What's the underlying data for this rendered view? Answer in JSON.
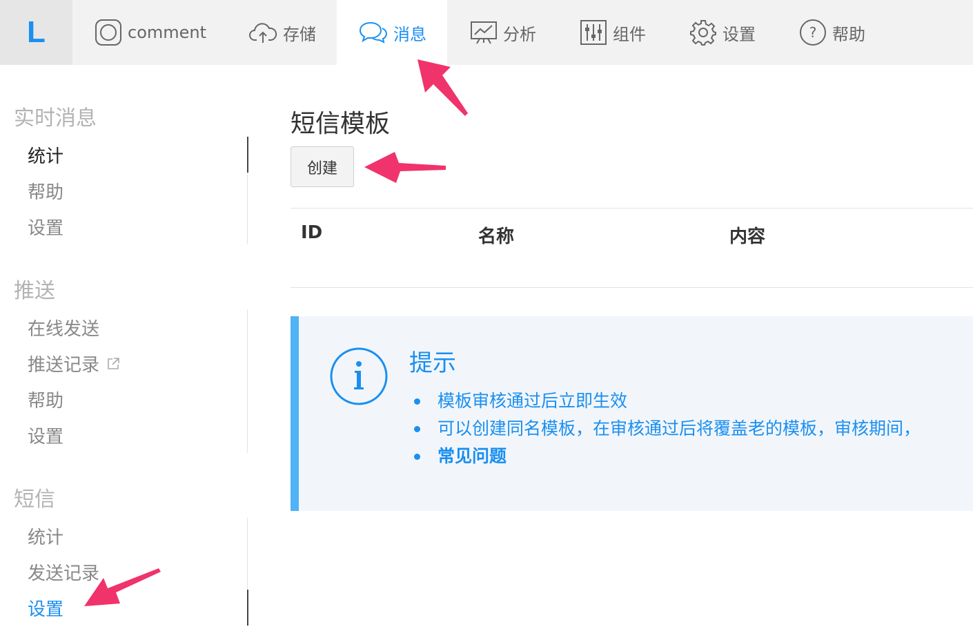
{
  "logo": "L",
  "nav": [
    {
      "label": "comment",
      "icon": "app-square-icon"
    },
    {
      "label": "存储",
      "icon": "cloud-upload-icon"
    },
    {
      "label": "消息",
      "icon": "chat-bubbles-icon",
      "active": true
    },
    {
      "label": "分析",
      "icon": "presentation-chart-icon"
    },
    {
      "label": "组件",
      "icon": "sliders-icon"
    },
    {
      "label": "设置",
      "icon": "gear-icon"
    },
    {
      "label": "帮助",
      "icon": "question-circle-icon"
    }
  ],
  "sidebar": {
    "sections": [
      {
        "title": "实时消息",
        "items": [
          {
            "label": "统计"
          },
          {
            "label": "帮助"
          },
          {
            "label": "设置"
          }
        ]
      },
      {
        "title": "推送",
        "items": [
          {
            "label": "在线发送"
          },
          {
            "label": "推送记录",
            "icon": "external-link-icon"
          },
          {
            "label": "帮助"
          },
          {
            "label": "设置"
          }
        ]
      },
      {
        "title": "短信",
        "items": [
          {
            "label": "统计"
          },
          {
            "label": "发送记录"
          },
          {
            "label": "设置",
            "selected": true
          }
        ]
      }
    ]
  },
  "main": {
    "title": "短信模板",
    "create_label": "创建",
    "table": {
      "headers": [
        "ID",
        "名称",
        "内容"
      ],
      "rows": []
    },
    "tip": {
      "title": "提示",
      "items": [
        "模板审核通过后立即生效",
        "可以创建同名模板，在审核通过后将覆盖老的模板，审核期间，",
        "常见问题"
      ]
    }
  },
  "colors": {
    "accent": "#1a8ff0",
    "annotation": "#f0336a",
    "tip_border": "#4fb3f6",
    "tip_bg": "#f2f6fb"
  }
}
